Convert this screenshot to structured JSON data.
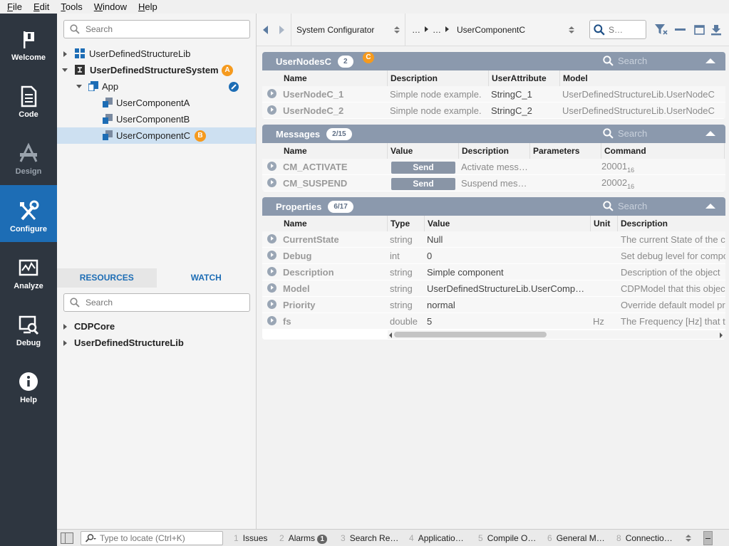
{
  "menu": [
    "File",
    "Edit",
    "Tools",
    "Window",
    "Help"
  ],
  "nav": [
    {
      "label": "Welcome",
      "icon": "flag-icon"
    },
    {
      "label": "Code",
      "icon": "document-icon"
    },
    {
      "label": "Design",
      "icon": "design-icon"
    },
    {
      "label": "Configure",
      "icon": "tools-icon"
    },
    {
      "label": "Analyze",
      "icon": "chart-icon"
    },
    {
      "label": "Debug",
      "icon": "debug-icon"
    },
    {
      "label": "Help",
      "icon": "info-icon"
    }
  ],
  "tree": {
    "search_placeholder": "Search",
    "items": [
      {
        "label": "UserDefinedStructureLib"
      },
      {
        "label": "UserDefinedStructureSystem",
        "badge": "A"
      },
      {
        "label": "App"
      },
      {
        "label": "UserComponentA"
      },
      {
        "label": "UserComponentB"
      },
      {
        "label": "UserComponentC",
        "badge": "B"
      }
    ]
  },
  "lower": {
    "tabs": [
      "RESOURCES",
      "WATCH"
    ],
    "search_placeholder": "Search",
    "items": [
      "CDPCore",
      "UserDefinedStructureLib"
    ]
  },
  "topbar": {
    "combo": "System Configurator",
    "crumb1": "…",
    "crumb2": "…",
    "crumb3": "UserComponentC",
    "search_placeholder": "S…"
  },
  "nodes": {
    "title": "UserNodesC",
    "count": "2",
    "badge": "C",
    "search_placeholder": "Search",
    "columns": [
      "Name",
      "Description",
      "UserAttribute",
      "Model"
    ],
    "rows": [
      [
        "UserNodeC_1",
        "Simple node example.",
        "StringC_1",
        "UserDefinedStructureLib.UserNodeC"
      ],
      [
        "UserNodeC_2",
        "Simple node example.",
        "StringC_2",
        "UserDefinedStructureLib.UserNodeC"
      ]
    ]
  },
  "messages": {
    "title": "Messages",
    "count": "2/15",
    "search_placeholder": "Search",
    "columns": [
      "Name",
      "Value",
      "Description",
      "Parameters",
      "Command"
    ],
    "rows": [
      {
        "name": "CM_ACTIVATE",
        "value": "Send",
        "desc": "Activate mess…",
        "params": "",
        "cmd": "20001",
        "base": "16"
      },
      {
        "name": "CM_SUSPEND",
        "value": "Send",
        "desc": "Suspend mes…",
        "params": "",
        "cmd": "20002",
        "base": "16"
      }
    ]
  },
  "properties": {
    "title": "Properties",
    "count": "6/17",
    "search_placeholder": "Search",
    "columns": [
      "Name",
      "Type",
      "Value",
      "Unit",
      "Description"
    ],
    "rows": [
      [
        "CurrentState",
        "string",
        "Null",
        "",
        "The current State of the c"
      ],
      [
        "Debug",
        "int",
        "0",
        "",
        "Set debug level for compo"
      ],
      [
        "Description",
        "string",
        "Simple component",
        "",
        "Description of the object"
      ],
      [
        "Model",
        "string",
        "UserDefinedStructureLib.UserComp…",
        "",
        "CDPModel that this objec"
      ],
      [
        "Priority",
        "string",
        "normal",
        "",
        "Override default model pr"
      ],
      [
        "fs",
        "double",
        "5",
        "Hz",
        "The Frequency [Hz] that t"
      ]
    ]
  },
  "status": {
    "locate_placeholder": "Type to locate (Ctrl+K)",
    "items": [
      {
        "n": "1",
        "label": "Issues"
      },
      {
        "n": "2",
        "label": "Alarms",
        "count": "1"
      },
      {
        "n": "3",
        "label": "Search Re…"
      },
      {
        "n": "4",
        "label": "Applicatio…"
      },
      {
        "n": "5",
        "label": "Compile O…"
      },
      {
        "n": "6",
        "label": "General M…"
      },
      {
        "n": "8",
        "label": "Connectio…"
      }
    ]
  },
  "colors": {
    "nav_bg": "#2e3640",
    "nav_active": "#1d6db5",
    "panel_header": "#8b99ad",
    "badge": "#f59a1e",
    "selection": "#cde0f1"
  }
}
